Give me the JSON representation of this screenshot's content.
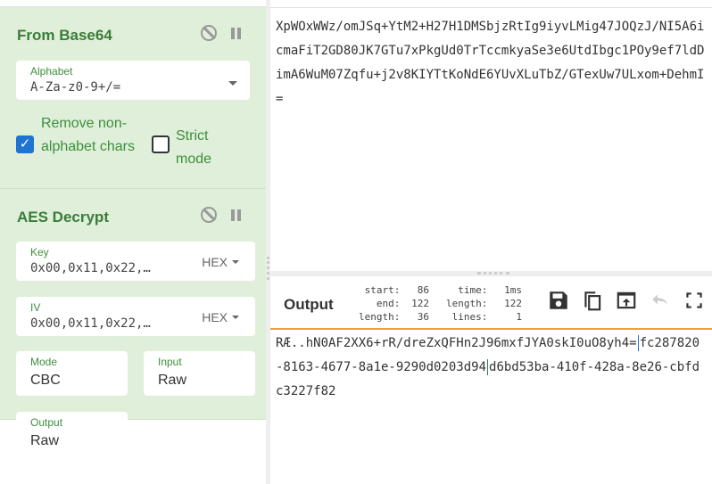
{
  "recipe": [
    {
      "title": "From Base64",
      "alphabet_label": "Alphabet",
      "alphabet_value": "A-Za-z0-9+/=",
      "remove_nonalpha_label": "Remove non-alphabet chars",
      "remove_nonalpha_checked": true,
      "strict_label": "Strict mode",
      "strict_checked": false
    },
    {
      "title": "AES Decrypt",
      "key_label": "Key",
      "key_value": "0x00,0x11,0x22,…",
      "key_format": "HEX",
      "iv_label": "IV",
      "iv_value": "0x00,0x11,0x22,…",
      "iv_format": "HEX",
      "mode_label": "Mode",
      "mode_value": "CBC",
      "input_label": "Input",
      "input_value": "Raw",
      "output_label": "Output",
      "output_value": "Raw"
    }
  ],
  "input_text": "XpWOxWWz/omJSq+YtM2+H27H1DMSbjzRtIg9iyvLMig47JOQzJ/NI5A6icmaFiT2GD80JK7GTu7xPkgUd0TrTccmkyaSe3e6UtdIbgc1POy9ef7ldDimA6WuM07Zqfu+j2v8KIYTtKoNdE6YUvXLuTbZ/GTexUw7ULxom+DehmI=",
  "output": {
    "title": "Output",
    "start_label": "start:",
    "start": "86",
    "end_label": "end:",
    "end": "122",
    "sel_length_label": "length:",
    "sel_length": "36",
    "time_label": "time:",
    "time": "1ms",
    "length_label": "length:",
    "length": "122",
    "lines_label": "lines:",
    "lines": "1",
    "text_parts": [
      "RÆ..hN0AF2XX6+rR/dreZxQFHn2J96mxfJYA0skI0uO8yh4=",
      "fc287820-8163-4677-8a1e-9290d0203d94",
      "d6bd53ba-410f-428a-8e26-cbfdc3227f82"
    ]
  }
}
